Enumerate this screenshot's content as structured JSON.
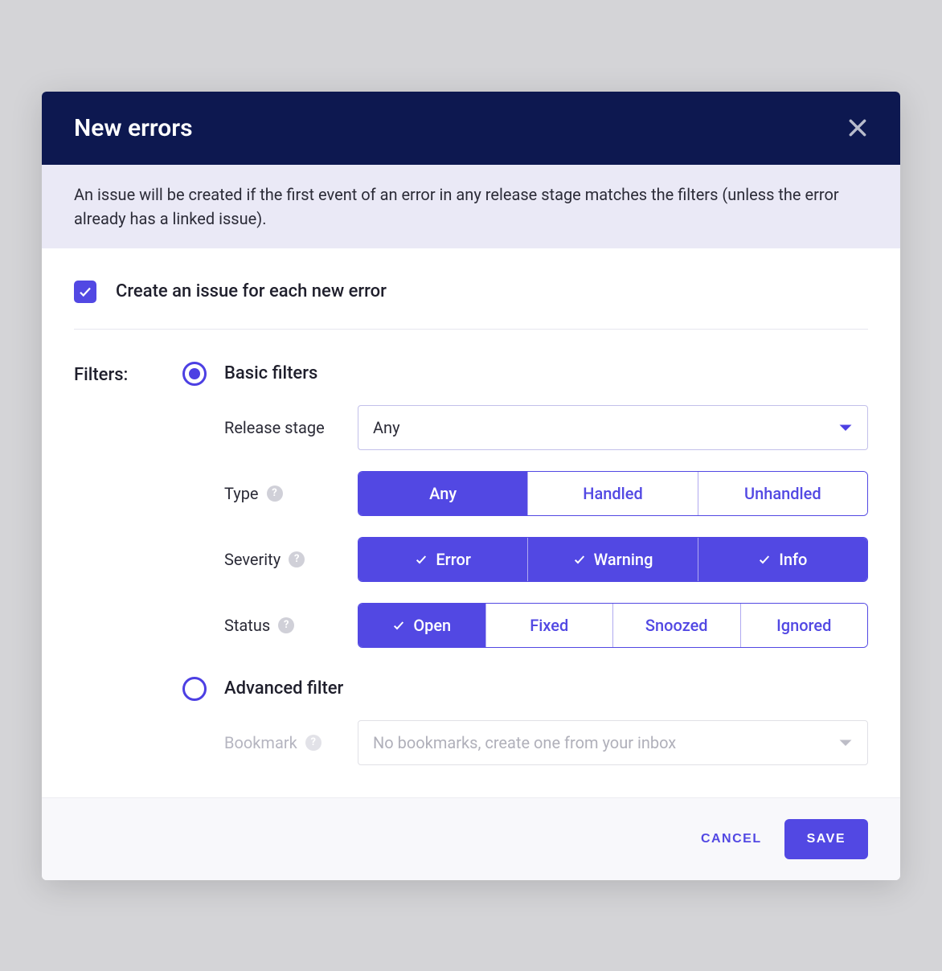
{
  "header": {
    "title": "New errors"
  },
  "description": "An issue will be created if the first event of an error in any release stage matches the filters (unless the error already has a linked issue).",
  "checkbox": {
    "label": "Create an issue for each new error",
    "checked": true
  },
  "filters": {
    "label": "Filters:",
    "basic": {
      "radio_label": "Basic filters",
      "selected": true,
      "release_stage": {
        "label": "Release stage",
        "value": "Any"
      },
      "type": {
        "label": "Type",
        "options": [
          {
            "label": "Any",
            "active": true
          },
          {
            "label": "Handled",
            "active": false
          },
          {
            "label": "Unhandled",
            "active": false
          }
        ]
      },
      "severity": {
        "label": "Severity",
        "options": [
          {
            "label": "Error",
            "active": true
          },
          {
            "label": "Warning",
            "active": true
          },
          {
            "label": "Info",
            "active": true
          }
        ]
      },
      "status": {
        "label": "Status",
        "options": [
          {
            "label": "Open",
            "active": true
          },
          {
            "label": "Fixed",
            "active": false
          },
          {
            "label": "Snoozed",
            "active": false
          },
          {
            "label": "Ignored",
            "active": false
          }
        ]
      }
    },
    "advanced": {
      "radio_label": "Advanced filter",
      "selected": false,
      "bookmark": {
        "label": "Bookmark",
        "placeholder": "No bookmarks, create one from your inbox"
      }
    }
  },
  "footer": {
    "cancel": "CANCEL",
    "save": "SAVE"
  }
}
